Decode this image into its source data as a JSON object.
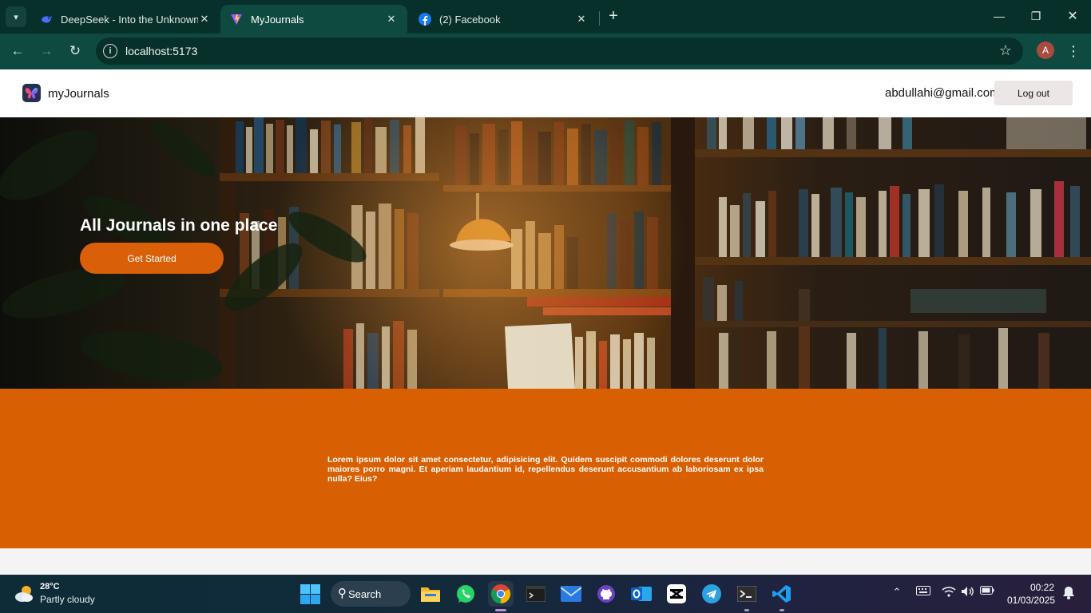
{
  "browser": {
    "tabs": [
      {
        "title": "DeepSeek - Into the Unknown",
        "icon": "deepseek-favicon-icon",
        "active": false
      },
      {
        "title": "MyJournals",
        "icon": "vite-favicon-icon",
        "active": true
      },
      {
        "title": "(2) Facebook",
        "icon": "facebook-favicon-icon",
        "active": false
      }
    ],
    "url": "localhost:5173",
    "profile_initial": "A",
    "theme_color": "#0f4a40"
  },
  "site": {
    "brand": "myJournals",
    "user_email": "abdullahi@gmail.com",
    "logout_label": "Log out",
    "hero": {
      "title": "All Journals in one place",
      "cta_label": "Get Started"
    },
    "about_text": "Lorem ipsum dolor sit amet consectetur, adipisicing elit. Quidem suscipit commodi dolores deserunt dolor maiores porro magni. Et aperiam laudantium id, repellendus deserunt accusantium ab laboriosam ex ipsa nulla? Eius?",
    "accent_color": "#d95f03"
  },
  "taskbar": {
    "weather": {
      "temp": "28°C",
      "condition": "Partly cloudy"
    },
    "search_label": "Search",
    "apps": [
      "file-explorer",
      "whatsapp",
      "chrome",
      "terminal",
      "mail",
      "github",
      "outlook",
      "capcut",
      "telegram",
      "command-prompt",
      "vscode"
    ],
    "clock": {
      "time": "00:22",
      "date": "01/03/2025"
    }
  }
}
